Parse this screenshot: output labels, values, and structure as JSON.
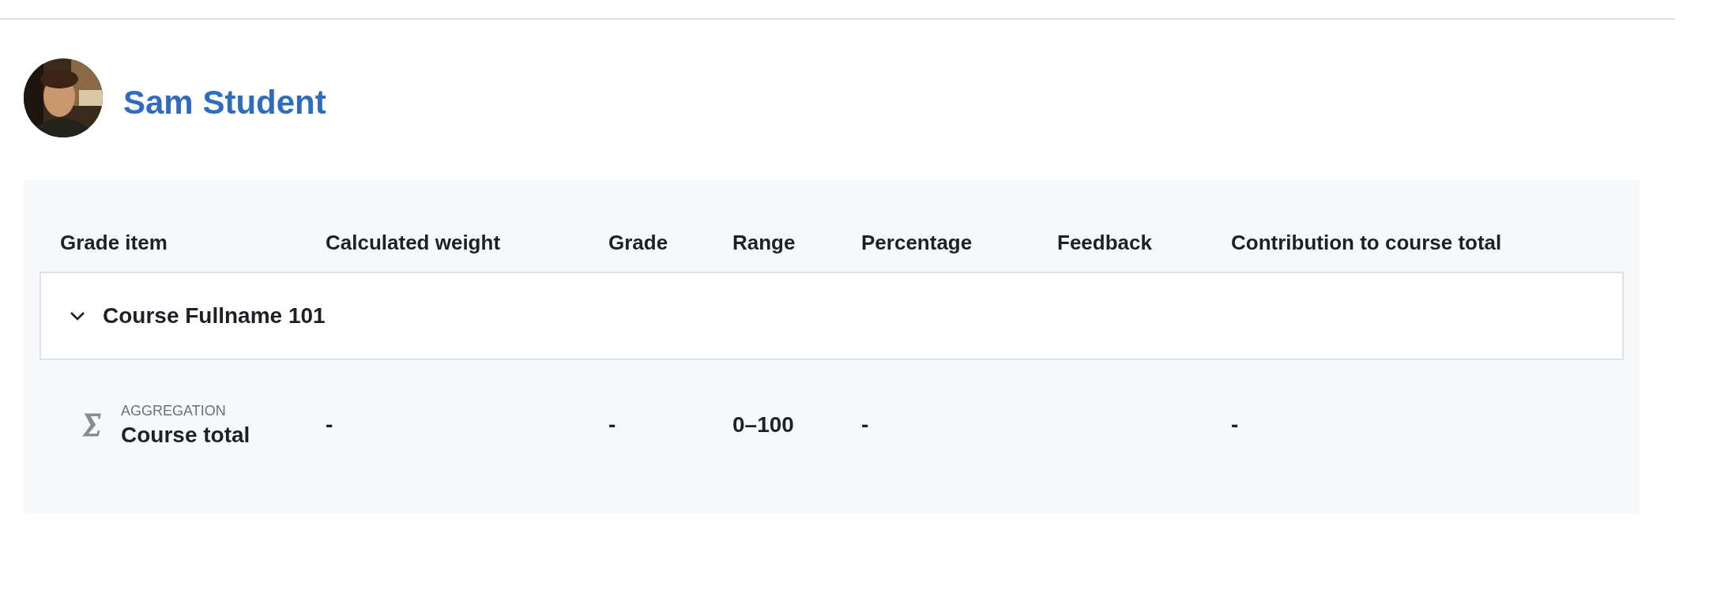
{
  "user": {
    "name": "Sam Student"
  },
  "table": {
    "columns": [
      "Grade item",
      "Calculated weight",
      "Grade",
      "Range",
      "Percentage",
      "Feedback",
      "Contribution to course total"
    ],
    "category": {
      "name": "Course Fullname 101",
      "expanded": true
    },
    "rows": [
      {
        "kind": "aggregation",
        "grade_item": {
          "type_label": "AGGREGATION",
          "name": "Course total"
        },
        "calculated_weight": "-",
        "grade": "-",
        "range": "0–100",
        "percentage": "-",
        "contribution_to_course_total": "-"
      }
    ]
  }
}
